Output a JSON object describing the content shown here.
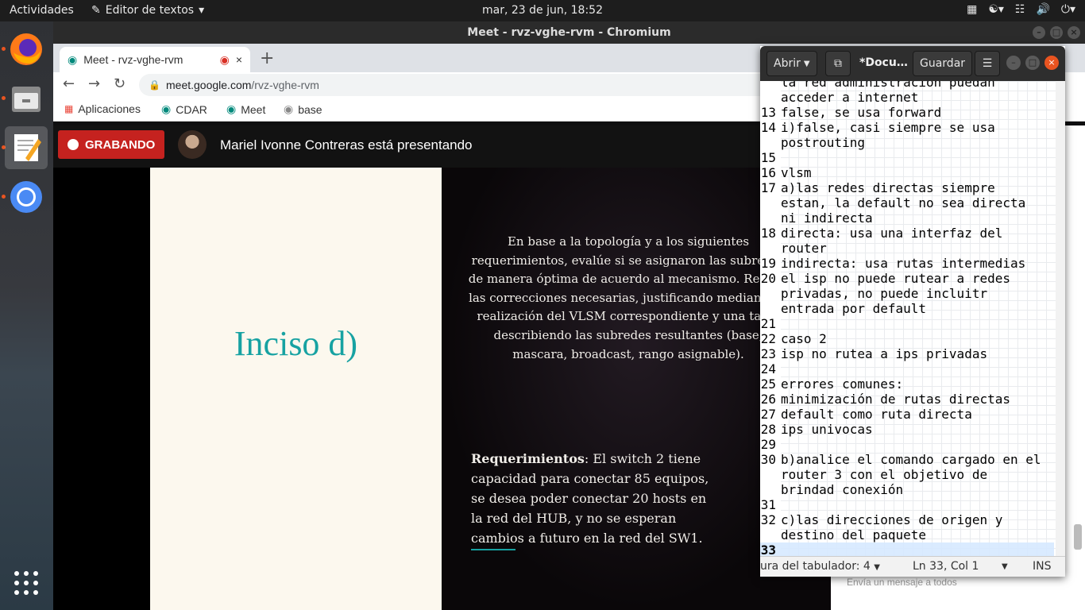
{
  "topbar": {
    "activities": "Actividades",
    "app_name": "Editor de textos",
    "clock": "mar, 23 de jun, 18:52"
  },
  "dock": {
    "items": [
      "firefox",
      "files",
      "text-editor",
      "chromium",
      "show-apps"
    ]
  },
  "chrome": {
    "window_title": "Meet - rvz-vghe-rvm - Chromium",
    "tab_title": "Meet - rvz-vghe-rvm",
    "url_domain": "meet.google.com",
    "url_path": "/rvz-vghe-rvm",
    "bookmarks": [
      "Aplicaciones",
      "CDAR",
      "Meet",
      "base"
    ]
  },
  "meet": {
    "recording_label": "GRABANDO",
    "presenter_text": "Mariel Ivonne Contreras está presentando",
    "chat_placeholder": "Envía un mensaje a todos",
    "slide": {
      "heading": "Inciso d)",
      "paragraph": "En base a la topología y a los siguientes requerimientos, evalúe si se asignaron las subredes de manera óptima de acuerdo al mecanismo. Realice las correcciones necesarias, justificando mediante la realización del VLSM correspondiente y una tabla describiendo las subredes resultantes (base, mascara, broadcast, rango asignable).",
      "req_label": "Requerimientos",
      "req_text": ": El switch 2 tiene capacidad para conectar 85 equipos, se desea poder conectar 20 hosts en la red del HUB, y no se esperan cambios a futuro en la red del SW1."
    }
  },
  "gedit": {
    "open_label": "Abrir",
    "doc_title": "*Docu…",
    "save_label": "Guardar",
    "lines": [
      {
        "n": "",
        "t": "la red administracion puedan"
      },
      {
        "n": "",
        "t": "acceder a internet"
      },
      {
        "n": "13",
        "t": "false, se usa forward"
      },
      {
        "n": "14",
        "t": "i)false, casi siempre se usa"
      },
      {
        "n": "",
        "t": "postrouting"
      },
      {
        "n": "15",
        "t": ""
      },
      {
        "n": "16",
        "t": "vlsm"
      },
      {
        "n": "17",
        "t": "a)las redes directas siempre"
      },
      {
        "n": "",
        "t": "estan, la default no sea directa"
      },
      {
        "n": "",
        "t": "ni indirecta"
      },
      {
        "n": "18",
        "t": "directa: usa una interfaz del"
      },
      {
        "n": "",
        "t": "router"
      },
      {
        "n": "19",
        "t": "indirecta: usa rutas intermedias"
      },
      {
        "n": "20",
        "t": "el isp no puede rutear a redes"
      },
      {
        "n": "",
        "t": "privadas, no puede incluitr"
      },
      {
        "n": "",
        "t": "entrada por default"
      },
      {
        "n": "21",
        "t": ""
      },
      {
        "n": "22",
        "t": "caso 2"
      },
      {
        "n": "23",
        "t": "isp no rutea a ips privadas"
      },
      {
        "n": "24",
        "t": ""
      },
      {
        "n": "25",
        "t": "errores comunes:"
      },
      {
        "n": "26",
        "t": "minimización de rutas directas"
      },
      {
        "n": "27",
        "t": "default como ruta directa"
      },
      {
        "n": "28",
        "t": "ips univocas"
      },
      {
        "n": "29",
        "t": ""
      },
      {
        "n": "30",
        "t": "b)analice el comando cargado en el"
      },
      {
        "n": "",
        "t": "router 3 con el objetivo de"
      },
      {
        "n": "",
        "t": "brindad conexión"
      },
      {
        "n": "31",
        "t": ""
      },
      {
        "n": "32",
        "t": "c)las direcciones de origen y"
      },
      {
        "n": "",
        "t": "destino del paquete"
      },
      {
        "n": "33",
        "t": "",
        "current": true
      }
    ],
    "status_tab": "ura del tabulador: 4",
    "status_pos": "Ln 33, Col 1",
    "status_mode": "INS"
  }
}
